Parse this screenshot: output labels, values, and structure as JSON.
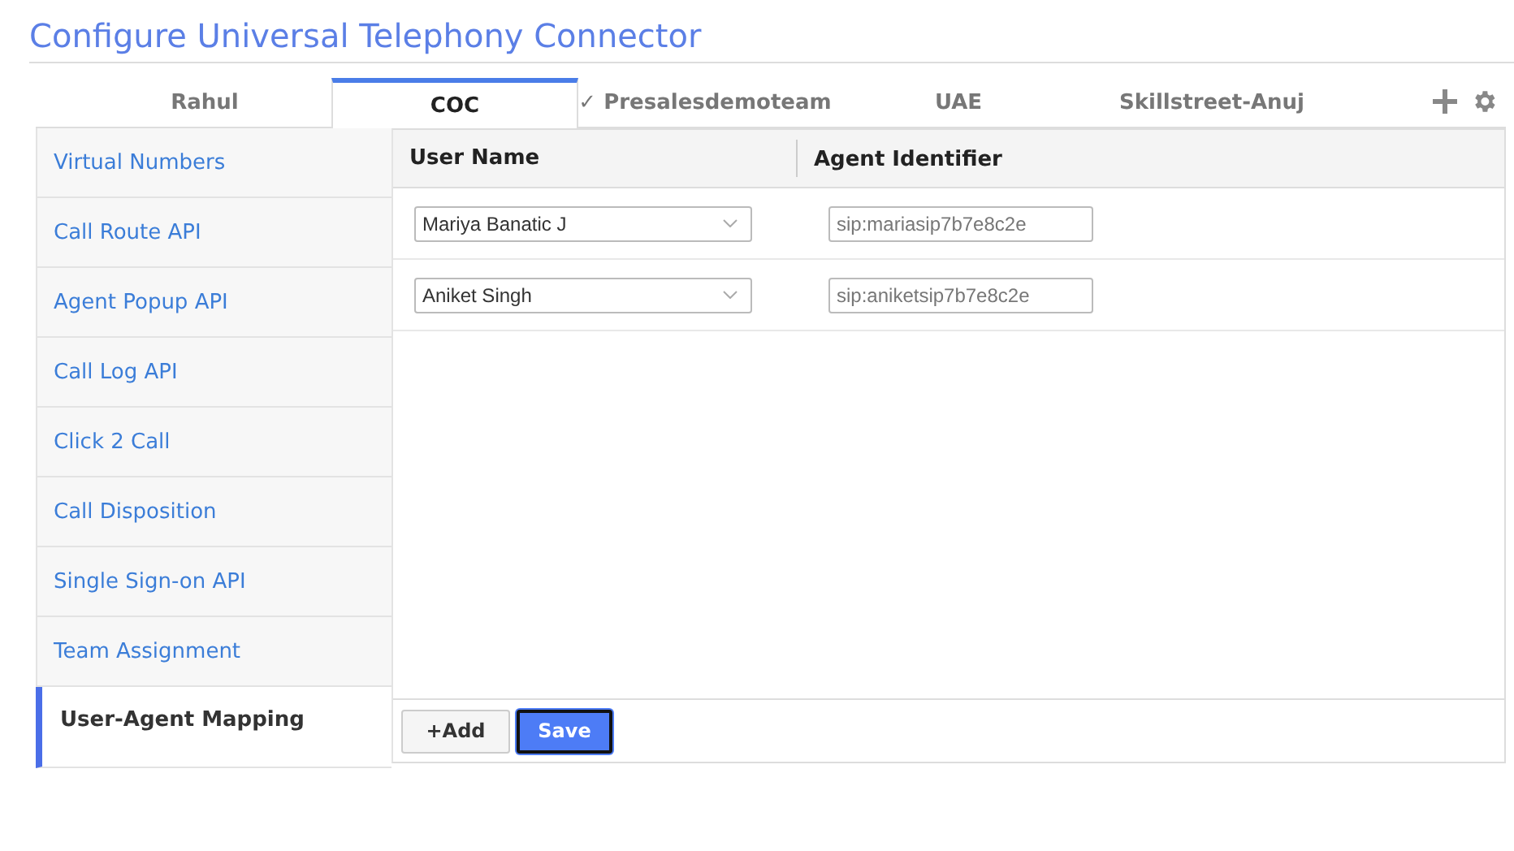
{
  "title": "Configure Universal Telephony Connector",
  "tabs": [
    {
      "label": "Rahul",
      "selected": false
    },
    {
      "label": "COC",
      "selected": true
    },
    {
      "label": "✓ Presalesdemoteam",
      "selected": false
    },
    {
      "label": "UAE",
      "selected": false
    },
    {
      "label": "Skillstreet-Anuj",
      "selected": false
    }
  ],
  "sidebar": {
    "items": [
      {
        "label": "Virtual Numbers",
        "selected": false
      },
      {
        "label": "Call Route API",
        "selected": false
      },
      {
        "label": "Agent Popup API",
        "selected": false
      },
      {
        "label": "Call Log API",
        "selected": false
      },
      {
        "label": "Click 2 Call",
        "selected": false
      },
      {
        "label": "Call Disposition",
        "selected": false
      },
      {
        "label": "Single Sign-on API",
        "selected": false
      },
      {
        "label": "Team Assignment",
        "selected": false
      },
      {
        "label": "User-Agent Mapping",
        "selected": true
      }
    ]
  },
  "table": {
    "columns": [
      "User Name",
      "Agent Identifier"
    ],
    "rows": [
      {
        "user": "Mariya Banatic J",
        "agent_placeholder": "sip:mariasip7b7e8c2e"
      },
      {
        "user": "Aniket Singh",
        "agent_placeholder": "sip:aniketsip7b7e8c2e"
      }
    ]
  },
  "buttons": [
    {
      "label": "+Add",
      "kind": "secondary"
    },
    {
      "label": "Save",
      "kind": "primary"
    }
  ]
}
